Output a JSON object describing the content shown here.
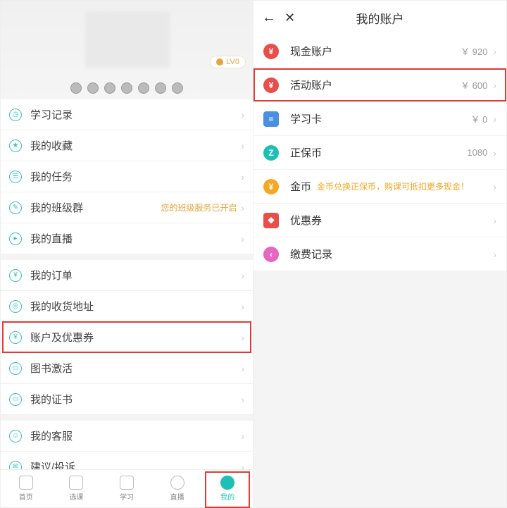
{
  "left": {
    "lv_badge": "LV0",
    "groups": [
      {
        "rows": [
          {
            "icon_glyph": "◷",
            "label": "学习记录"
          },
          {
            "icon_glyph": "★",
            "label": "我的收藏"
          },
          {
            "icon_glyph": "☰",
            "label": "我的任务"
          },
          {
            "icon_glyph": "✎",
            "label": "我的班级群",
            "extra": "您的班级服务已开启"
          },
          {
            "icon_glyph": "▸",
            "label": "我的直播"
          }
        ]
      },
      {
        "rows": [
          {
            "icon_glyph": "¥",
            "label": "我的订单"
          },
          {
            "icon_glyph": "◎",
            "label": "我的收货地址"
          },
          {
            "icon_glyph": "¥",
            "label": "账户及优惠券",
            "highlight": true
          },
          {
            "icon_glyph": "▭",
            "label": "图书激活"
          },
          {
            "icon_glyph": "▭",
            "label": "我的证书"
          }
        ]
      },
      {
        "rows": [
          {
            "icon_glyph": "☺",
            "label": "我的客服"
          },
          {
            "icon_glyph": "✉",
            "label": "建议/投诉"
          }
        ]
      }
    ],
    "tabs": [
      {
        "label": "首页",
        "icon": "home"
      },
      {
        "label": "选课",
        "icon": "bag"
      },
      {
        "label": "学习",
        "icon": "book"
      },
      {
        "label": "直播",
        "icon": "play"
      },
      {
        "label": "我的",
        "icon": "me",
        "active": true,
        "highlight": true
      }
    ]
  },
  "right": {
    "title": "我的账户",
    "rows": [
      {
        "color": "red",
        "glyph": "¥",
        "label": "现金账户",
        "value": "￥ 920"
      },
      {
        "color": "red",
        "glyph": "¥",
        "label": "活动账户",
        "value": "￥ 600",
        "highlight": true
      },
      {
        "color": "blue",
        "glyph": "≡",
        "label": "学习卡",
        "value": "￥ 0"
      },
      {
        "color": "teal",
        "glyph": "Z",
        "label": "正保币",
        "value": "1080"
      },
      {
        "color": "orange",
        "glyph": "¥",
        "label": "金币",
        "note": "金币兑换正保币，购课可抵扣更多现金！"
      },
      {
        "color": "redsq",
        "glyph": "❖",
        "label": "优惠券"
      },
      {
        "color": "pink",
        "glyph": "‹",
        "label": "缴费记录"
      }
    ]
  }
}
